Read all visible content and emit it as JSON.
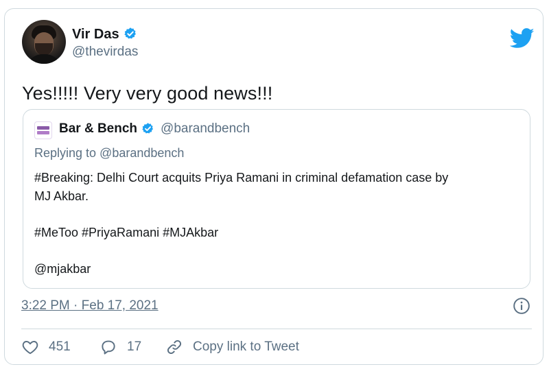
{
  "author": {
    "name": "Vir Das",
    "handle": "@thevirdas",
    "verified_color": "#1da1f2"
  },
  "tweet": {
    "text": "Yes!!!!! Very very good news!!!",
    "timestamp": "3:22 PM · Feb 17, 2021"
  },
  "quoted_tweet": {
    "name": "Bar & Bench",
    "handle": "@barandbench",
    "replying_to": "Replying to @barandbench",
    "body": {
      "line1": "#Breaking: Delhi Court acquits Priya Ramani in criminal defamation case by",
      "line2": "MJ Akbar.",
      "hashtags": " #MeToo #PriyaRamani #MJAkbar",
      "mention": "@mjakbar"
    }
  },
  "actions": {
    "likes": "451",
    "replies": "17",
    "copy_link": "Copy link to Tweet"
  },
  "icons": {
    "brand": "twitter-bird-icon",
    "verified": "verified-badge-icon",
    "info": "info-icon",
    "like": "heart-icon",
    "reply": "reply-bubble-icon",
    "link": "link-icon"
  },
  "colors": {
    "brand": "#1da1f2",
    "text": "#14171a",
    "secondary": "#5b7083",
    "border": "#cfd9de"
  }
}
